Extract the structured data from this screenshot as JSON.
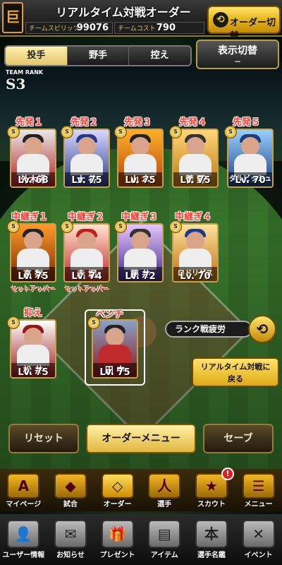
{
  "header": {
    "logo": "巨",
    "title": "リアルタイム対戦オーダー",
    "team_spirit_label": "チームスピリッツ",
    "team_spirit_value": "99076",
    "team_cost_label": "チームコスト",
    "team_cost_value": "790",
    "order_switch_label": "オーダー切替"
  },
  "tabs": [
    "投手",
    "野手",
    "控え"
  ],
  "display_switch": {
    "title": "表示切替",
    "sub": "−"
  },
  "team_rank": {
    "label": "TEAM RANK",
    "value": "S3"
  },
  "starters": [
    {
      "pos": "先発１",
      "name": "外木場",
      "lv": "Lv. 68"
    },
    {
      "pos": "先発２",
      "name": "大 谷",
      "lv": "Lv. 75"
    },
    {
      "pos": "先発３",
      "name": "山 本",
      "lv": "Lv. 75"
    },
    {
      "pos": "先発４",
      "name": "菅 野",
      "lv": "Lv. 75"
    },
    {
      "pos": "先発５",
      "name": "ダルビッシュ",
      "lv": "Lv. 70"
    }
  ],
  "relievers": [
    {
      "pos": "中継ぎ１",
      "name": "高 梨",
      "lv": "Lv. 75",
      "role": "セットアッパー"
    },
    {
      "pos": "中継ぎ２",
      "name": "赤 堀",
      "lv": "Lv. 74",
      "role": "セットアッパー"
    },
    {
      "pos": "中継ぎ３",
      "name": "藤 井",
      "lv": "Lv. 72",
      "role": ""
    },
    {
      "pos": "中継ぎ４",
      "name": "ロドリゲス",
      "lv": "Lv. 70",
      "role": ""
    }
  ],
  "closer": {
    "pos": "抑え",
    "name": "松 井",
    "lv": "Lv. 75"
  },
  "bench": {
    "pos": "ベンチ",
    "name": "田 中",
    "lv": "Lv. 75"
  },
  "badge_text": "S",
  "rank_fatigue_label": "ランク戦疲労",
  "back_label_1": "リアルタイム対戦に",
  "back_label_2": "戻る",
  "buttons": {
    "reset": "リセット",
    "order_menu": "オーダーメニュー",
    "save": "セーブ"
  },
  "menu1": [
    {
      "label": "マイページ",
      "icon": "A"
    },
    {
      "label": "試合",
      "icon": "◆"
    },
    {
      "label": "オーダー",
      "icon": "◇"
    },
    {
      "label": "選手",
      "icon": "人"
    },
    {
      "label": "スカウト",
      "icon": "★",
      "notif": "!"
    },
    {
      "label": "メニュー",
      "icon": "☰"
    }
  ],
  "menu2": [
    {
      "label": "ユーザー情報",
      "icon": "👤"
    },
    {
      "label": "お知らせ",
      "icon": "✉"
    },
    {
      "label": "プレゼント",
      "icon": "🎁"
    },
    {
      "label": "アイテム",
      "icon": "▤"
    },
    {
      "label": "選手名鑑",
      "icon": "本"
    },
    {
      "label": "イベント",
      "icon": "✕"
    }
  ],
  "colors": {
    "accent_gold": "#e8b51a",
    "position_red": "#ff3b30"
  }
}
